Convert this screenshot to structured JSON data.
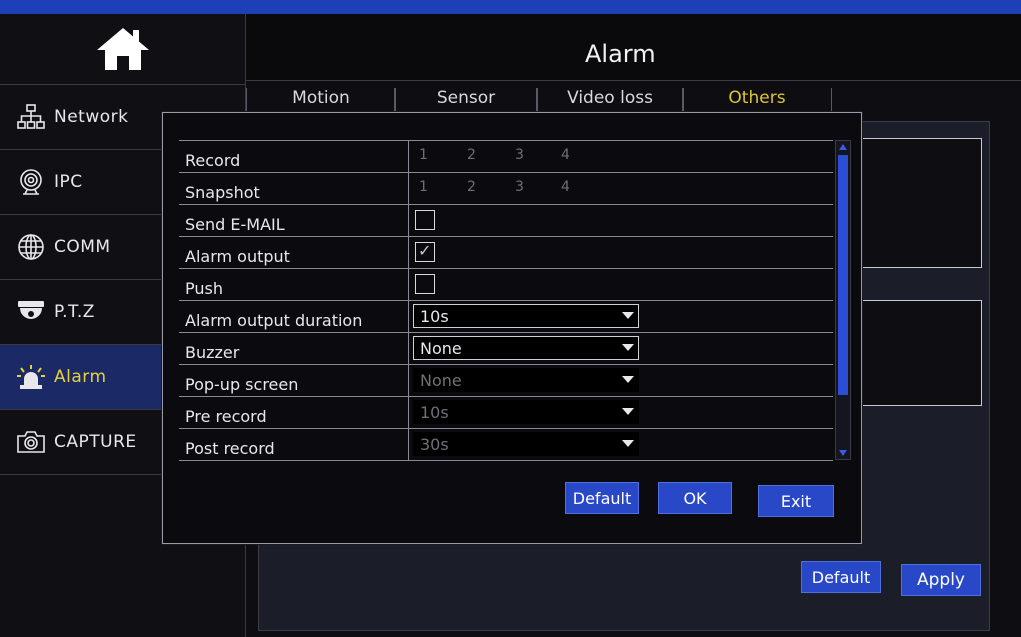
{
  "header": {
    "title": "Alarm"
  },
  "sidebar": {
    "items": [
      {
        "label": "Network",
        "icon": "network-icon"
      },
      {
        "label": "IPC",
        "icon": "camera-icon"
      },
      {
        "label": "COMM",
        "icon": "globe-icon"
      },
      {
        "label": "P.T.Z",
        "icon": "dome-camera-icon"
      },
      {
        "label": "Alarm",
        "icon": "alarm-siren-icon"
      },
      {
        "label": "CAPTURE",
        "icon": "capture-camera-icon"
      }
    ]
  },
  "tabs": [
    {
      "label": "Motion"
    },
    {
      "label": "Sensor"
    },
    {
      "label": "Video loss"
    },
    {
      "label": "Others"
    }
  ],
  "dialog": {
    "rows": {
      "record": {
        "label": "Record",
        "channels": [
          "1",
          "2",
          "3",
          "4"
        ]
      },
      "snapshot": {
        "label": "Snapshot",
        "channels": [
          "1",
          "2",
          "3",
          "4"
        ]
      },
      "send_email": {
        "label": "Send E-MAIL",
        "checked": false
      },
      "alarm_output": {
        "label": "Alarm output",
        "checked": true
      },
      "push": {
        "label": "Push",
        "checked": false
      },
      "alarm_output_duration": {
        "label": "Alarm output duration",
        "value": "10s"
      },
      "buzzer": {
        "label": "Buzzer",
        "value": "None"
      },
      "popup_screen": {
        "label": "Pop-up screen",
        "value": "None"
      },
      "pre_record": {
        "label": "Pre record",
        "value": "10s"
      },
      "post_record": {
        "label": "Post record",
        "value": "30s"
      }
    },
    "buttons": {
      "default": "Default",
      "ok": "OK",
      "exit": "Exit"
    }
  },
  "page_buttons": {
    "default": "Default",
    "apply": "Apply"
  },
  "colors": {
    "accent_blue": "#2848c8",
    "active_text": "#e0c536",
    "active_nav_bg": "#1b2a66"
  }
}
